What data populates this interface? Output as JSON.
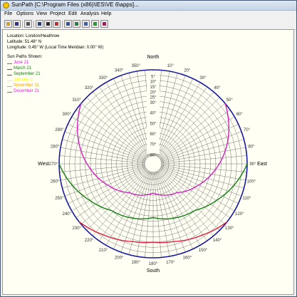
{
  "window": {
    "title": "SunPath [C:\\Program Files (x86)\\IES\\VE 6\\apps]..."
  },
  "menu": [
    "File",
    "Options",
    "View",
    "Project",
    "Edit",
    "Analysis",
    "Help"
  ],
  "toolbar": {
    "buttons": [
      {
        "name": "open-folder-icon",
        "color": "#d8a020"
      },
      {
        "name": "save-icon",
        "color": "#303090"
      },
      {
        "name": "print-icon",
        "color": "#505050"
      },
      {
        "name": "table-icon",
        "color": "#204080"
      },
      {
        "name": "sun-view-icon",
        "color": "#303030"
      },
      {
        "name": "color-bars-icon",
        "color": "#c03030"
      },
      {
        "name": "document-icon",
        "color": "#3050a0"
      },
      {
        "name": "globe-icon",
        "color": "#208040"
      },
      {
        "name": "copy-icon",
        "color": "#4060a0"
      },
      {
        "name": "chart-icon",
        "color": "#20a020"
      },
      {
        "name": "book-icon",
        "color": "#a02060"
      }
    ]
  },
  "location": {
    "line1": "Location: London/Heathrow",
    "line2": "Latitude: 51.48° N",
    "line3": "Longitude: 0.45° W (Local Time Meridian: 0.00° W)"
  },
  "legend": {
    "heading": "Sun Paths Shown:",
    "items": [
      {
        "label": "June 21",
        "color": "#e020e0"
      },
      {
        "label": "March 21",
        "color": "#108010"
      },
      {
        "label": "September 21",
        "color": "#108010"
      },
      {
        "label": "January 1",
        "color": "#ffff00"
      },
      {
        "label": "November 21",
        "color": "#ffa000"
      },
      {
        "label": "December 21",
        "color": "#e020e0"
      }
    ]
  },
  "compass": {
    "north": "North",
    "south": "South",
    "east": "East",
    "west": "West",
    "azimuth_labels": [
      "350°",
      "10°",
      "20°",
      "30°",
      "40°",
      "50°",
      "60°",
      "70°",
      "80°",
      "90°",
      "100°",
      "110°",
      "120°",
      "130°",
      "140°",
      "150°",
      "160°",
      "170°",
      "180°",
      "190°",
      "200°",
      "210°",
      "220°",
      "230°",
      "240°",
      "250°",
      "260°",
      "270°",
      "280°",
      "290°",
      "300°",
      "310°",
      "320°",
      "330°",
      "340°"
    ],
    "altitude_labels": [
      "5°",
      "10°",
      "15°",
      "20°",
      "25°",
      "30°",
      "40°",
      "50°",
      "60°",
      "70°",
      "80°"
    ]
  },
  "sun_paths": {
    "june21": {
      "color": "#d020c0",
      "altitude": [
        [
          -130,
          0
        ],
        [
          -115,
          10
        ],
        [
          -100,
          20
        ],
        [
          -85,
          30
        ],
        [
          -65,
          42
        ],
        [
          -40,
          54
        ],
        [
          0,
          62
        ],
        [
          40,
          54
        ],
        [
          65,
          42
        ],
        [
          85,
          30
        ],
        [
          100,
          20
        ],
        [
          115,
          10
        ],
        [
          130,
          0
        ]
      ]
    },
    "equinox": {
      "color": "#108010",
      "altitude": [
        [
          -90,
          0
        ],
        [
          -75,
          10
        ],
        [
          -60,
          20
        ],
        [
          -42,
          30
        ],
        [
          0,
          38.5
        ],
        [
          42,
          30
        ],
        [
          60,
          20
        ],
        [
          75,
          10
        ],
        [
          90,
          0
        ]
      ]
    },
    "december21": {
      "color": "#e02040",
      "altitude": [
        [
          -52,
          0
        ],
        [
          -35,
          7
        ],
        [
          -15,
          13
        ],
        [
          0,
          15
        ],
        [
          15,
          13
        ],
        [
          35,
          7
        ],
        [
          52,
          0
        ]
      ]
    }
  },
  "colors": {
    "horizon_ring": "#1a1aa0",
    "grid": "#555555"
  }
}
